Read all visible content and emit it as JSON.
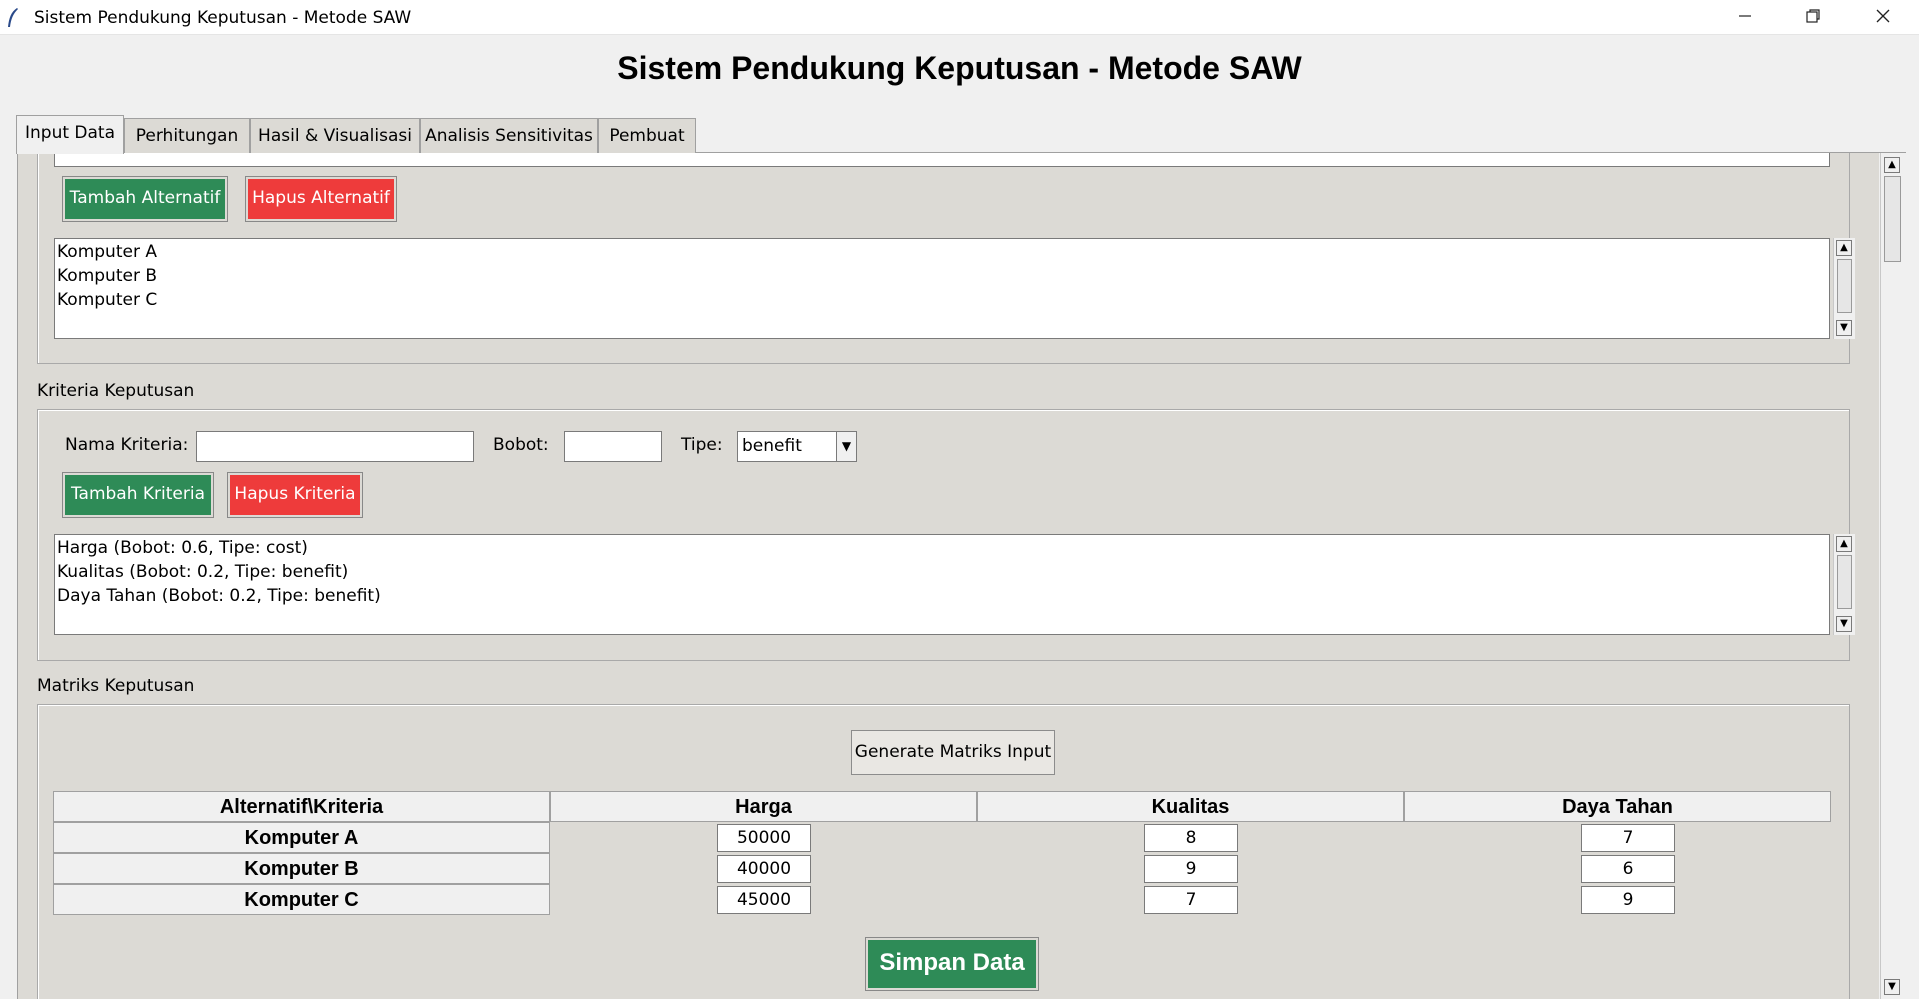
{
  "window": {
    "title": "Sistem Pendukung Keputusan - Metode SAW",
    "icon": "feather-icon",
    "controls": {
      "minimize": "—",
      "restore": "❐",
      "close": "✕"
    }
  },
  "heading": "Sistem Pendukung Keputusan - Metode SAW",
  "tabs": [
    {
      "label": "Input Data",
      "active": true
    },
    {
      "label": "Perhitungan",
      "active": false
    },
    {
      "label": "Hasil & Visualisasi",
      "active": false
    },
    {
      "label": "Analisis Sensitivitas",
      "active": false
    },
    {
      "label": "Pembuat",
      "active": false
    }
  ],
  "alternatif": {
    "add_button": "Tambah Alternatif",
    "delete_button": "Hapus Alternatif",
    "items": [
      "Komputer A",
      "Komputer B",
      "Komputer C"
    ]
  },
  "kriteria": {
    "section_label": "Kriteria Keputusan",
    "name_label": "Nama Kriteria:",
    "name_value": "",
    "weight_label": "Bobot:",
    "weight_value": "",
    "type_label": "Tipe:",
    "type_value": "benefit",
    "add_button": "Tambah Kriteria",
    "delete_button": "Hapus Kriteria",
    "items": [
      "Harga (Bobot: 0.6, Tipe: cost)",
      "Kualitas (Bobot: 0.2, Tipe: benefit)",
      "Daya Tahan (Bobot: 0.2, Tipe: benefit)"
    ]
  },
  "matriks": {
    "section_label": "Matriks Keputusan",
    "generate_button": "Generate Matriks Input",
    "header_corner": "Alternatif\\Kriteria",
    "columns": [
      "Harga",
      "Kualitas",
      "Daya Tahan"
    ],
    "rows": [
      {
        "name": "Komputer A",
        "values": [
          "50000",
          "8",
          "7"
        ]
      },
      {
        "name": "Komputer B",
        "values": [
          "40000",
          "9",
          "6"
        ]
      },
      {
        "name": "Komputer C",
        "values": [
          "45000",
          "7",
          "9"
        ]
      }
    ],
    "save_button": "Simpan Data"
  },
  "colors": {
    "green": "#2e8b57",
    "red": "#ee3b3b",
    "background": "#dcdad5"
  }
}
